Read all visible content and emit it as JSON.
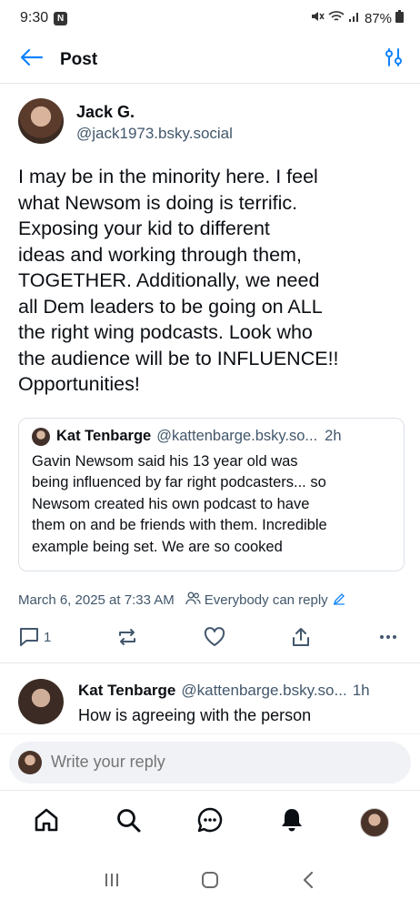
{
  "status_bar": {
    "time": "9:30",
    "notification_badge": "N",
    "battery": "87%"
  },
  "header": {
    "title": "Post"
  },
  "post": {
    "author_name": "Jack G.",
    "author_handle": "@jack1973.bsky.social",
    "text": "I may be in the minority here. I feel\nwhat Newsom is doing is terrific.\nExposing your kid to different\nideas and working through them,\nTOGETHER. Additionally, we need\nall Dem leaders to be going on ALL\nthe right wing podcasts. Look who\nthe audience will be to INFLUENCE!!\nOpportunities!",
    "quote": {
      "author_name": "Kat Tenbarge",
      "author_handle": "@kattenbarge.bsky.so...",
      "time": "2h",
      "text": "Gavin Newsom said his 13 year old was\nbeing influenced by far right podcasters... so\nNewsom created his own podcast to have\nthem on and be friends with them. Incredible\nexample being set. We are so cooked"
    },
    "timestamp": "March 6, 2025 at 7:33 AM",
    "reply_permission": "Everybody can reply",
    "reply_count": "1"
  },
  "reply": {
    "author_name": "Kat Tenbarge",
    "author_handle": "@kattenbarge.bsky.so...",
    "time": "1h",
    "text": "How is agreeing with the person"
  },
  "composer": {
    "placeholder": "Write your reply"
  },
  "bottom_nav": {
    "items": [
      "home-icon",
      "search-icon",
      "chat-icon",
      "notifications-icon",
      "profile-avatar"
    ]
  },
  "colors": {
    "accent": "#1083fe",
    "muted_text": "#42576c",
    "border": "#e6e9ee"
  }
}
